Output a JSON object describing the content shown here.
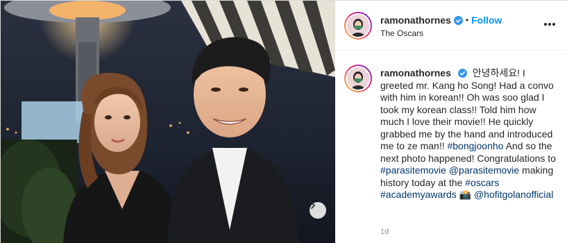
{
  "post": {
    "username": "ramonathornes",
    "follow_label": "Follow",
    "dot": "•",
    "location": "The Oscars",
    "caption": {
      "username": "ramonathornes",
      "text_1": "안녕하세요! I greeted mr. Kang ho Song! Had a convo with him in korean!! Oh was soo glad I took my korean class!! Told him how much I love their movie!! He quickly grabbed me by the hand and introduced me to ze man!!",
      "tag_bongjoonho": "#bongjoonho",
      "text_2": "And so the next photo happened! Congratulations to",
      "tag_parasitemovie": "#parasitemovie",
      "mention_parasitemovie": "@parasitemovie",
      "text_3": "making history today at the",
      "tag_oscars": "#oscars",
      "tag_academyawards": "#academyawards",
      "emoji": "📸",
      "mention_hofit": "@hofitgolanofficial"
    },
    "timestamp": "1d"
  },
  "icons": {
    "verified": "verified-badge-icon",
    "more": "more-options-icon",
    "next": "chevron-right-icon"
  },
  "colors": {
    "link": "#00376b",
    "follow": "#0095f6",
    "verified": "#3897f0",
    "muted": "#8e8e8e"
  }
}
